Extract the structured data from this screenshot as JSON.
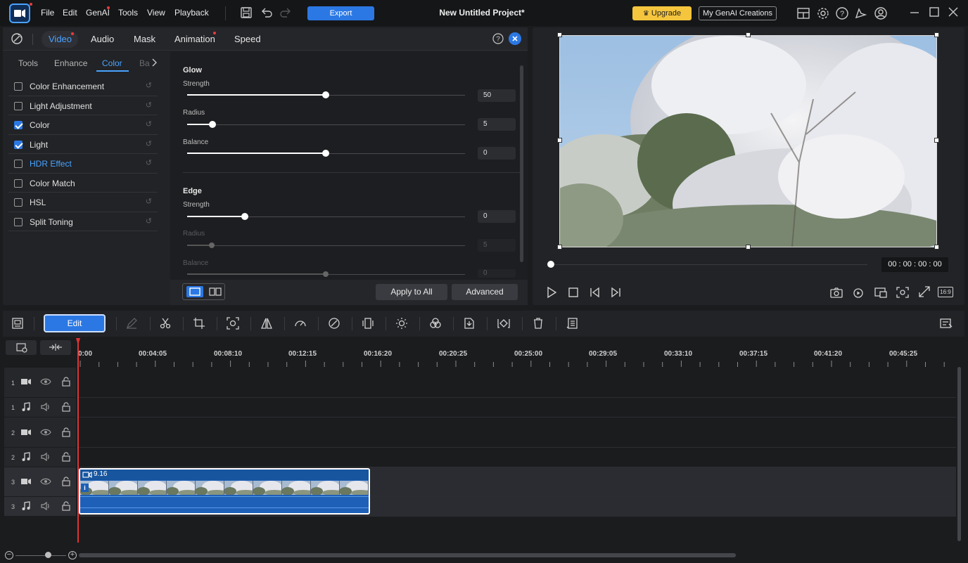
{
  "app": {
    "menu": [
      "File",
      "Edit",
      "GenAI",
      "Tools",
      "View",
      "Playback"
    ],
    "export_label": "Export",
    "project_title": "New Untitled Project*",
    "upgrade_label": "Upgrade",
    "genai_creations_label": "My GenAI Creations"
  },
  "panel": {
    "tabs": [
      "Video",
      "Audio",
      "Mask",
      "Animation",
      "Speed"
    ],
    "active_tab": "Video",
    "subtabs": [
      "Tools",
      "Enhance",
      "Color",
      "Ba"
    ],
    "active_subtab": "Color",
    "effects": [
      {
        "label": "Color Enhancement",
        "checked": false
      },
      {
        "label": "Light Adjustment",
        "checked": false
      },
      {
        "label": "Color",
        "checked": true
      },
      {
        "label": "Light",
        "checked": true
      },
      {
        "label": "HDR Effect",
        "checked": false,
        "highlight": true
      },
      {
        "label": "Color Match",
        "checked": false
      },
      {
        "label": "HSL",
        "checked": false
      },
      {
        "label": "Split Toning",
        "checked": false
      }
    ],
    "glow": {
      "title": "Glow",
      "strength_label": "Strength",
      "strength": "50",
      "radius_label": "Radius",
      "radius": "5",
      "balance_label": "Balance",
      "balance": "0"
    },
    "edge": {
      "title": "Edge",
      "strength_label": "Strength",
      "strength": "0",
      "radius_label": "Radius",
      "radius": "5",
      "balance_label": "Balance",
      "balance": "0"
    },
    "apply_all_label": "Apply to All",
    "advanced_label": "Advanced"
  },
  "preview": {
    "timecode": "00 : 00 : 00 : 00",
    "aspect_label": "16:9"
  },
  "timeline": {
    "edit_label": "Edit",
    "ruler": [
      "0:00",
      "00:04:05",
      "00:08:10",
      "00:12:15",
      "00:16:20",
      "00:20:25",
      "00:25:00",
      "00:29:05",
      "00:33:10",
      "00:37:15",
      "00:41:20",
      "00:45:25"
    ],
    "tracks": [
      {
        "num": "1",
        "type": "video"
      },
      {
        "num": "1",
        "type": "audio"
      },
      {
        "num": "2",
        "type": "video"
      },
      {
        "num": "2",
        "type": "audio"
      },
      {
        "num": "3",
        "type": "video"
      },
      {
        "num": "3",
        "type": "audio"
      }
    ],
    "clip_label": "9.16"
  },
  "colors": {
    "accent": "#2b78e4",
    "upgrade": "#f5c53d",
    "playhead": "#dd3333"
  }
}
